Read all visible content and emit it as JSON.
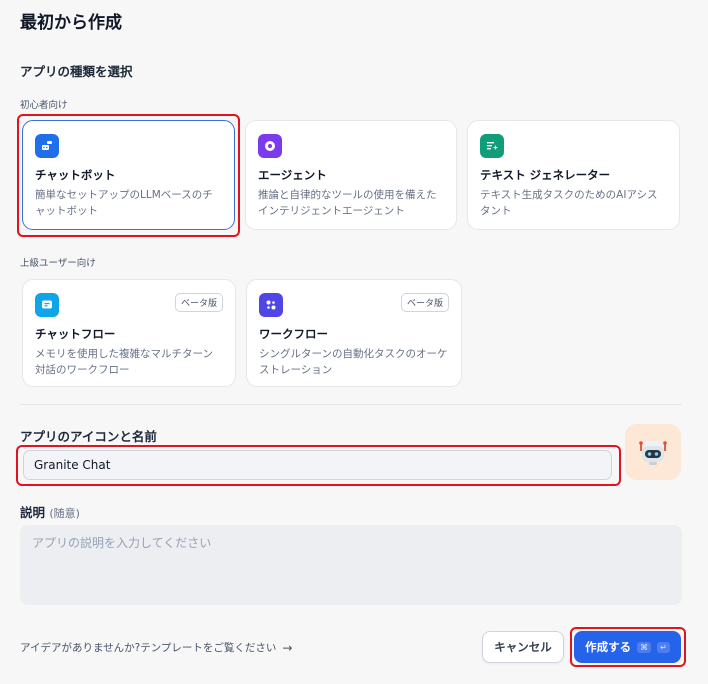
{
  "title": "最初から作成",
  "app_type_section": "アプリの種類を選択",
  "beginner_group": "初心者向け",
  "advanced_group": "上級ユーザー向け",
  "cards": {
    "chatbot": {
      "title": "チャットボット",
      "desc": "簡単なセットアップのLLMベースのチャットボット",
      "color": "#1f6feb"
    },
    "agent": {
      "title": "エージェント",
      "desc": "推論と自律的なツールの使用を備えたインテリジェントエージェント",
      "color": "#7c3aed"
    },
    "textgen": {
      "title": "テキスト ジェネレーター",
      "desc": "テキスト生成タスクのためのAIアシスタント",
      "color": "#0f9d7a"
    },
    "chatflow": {
      "title": "チャットフロー",
      "desc": "メモリを使用した複雑なマルチターン対話のワークフロー",
      "badge": "ベータ版",
      "color": "#0ea5e9"
    },
    "workflow": {
      "title": "ワークフロー",
      "desc": "シングルターンの自動化タスクのオーケストレーション",
      "badge": "ベータ版",
      "color": "#4f46e5"
    }
  },
  "name_section": {
    "label": "アプリのアイコンと名前",
    "value": "Granite Chat"
  },
  "description_section": {
    "label": "説明",
    "optional": "(随意)",
    "placeholder": "アプリの説明を入力してください"
  },
  "footer": {
    "template_link": "アイデアがありませんか?テンプレートをご覧ください",
    "cancel": "キャンセル",
    "create": "作成する",
    "shortcut_cmd": "⌘",
    "shortcut_enter": "↵"
  }
}
